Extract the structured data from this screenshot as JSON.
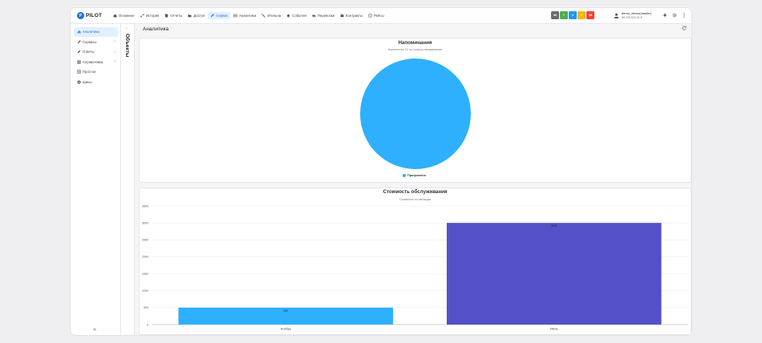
{
  "app": {
    "logo_text": "PILOT"
  },
  "nav": [
    {
      "label": "Основное",
      "icon": "home-icon",
      "active": false
    },
    {
      "label": "История",
      "icon": "route-icon",
      "active": false
    },
    {
      "label": "Отчёты",
      "icon": "document-icon",
      "active": false
    },
    {
      "label": "Доступ",
      "icon": "folder-icon",
      "active": false
    },
    {
      "label": "Сервис",
      "icon": "wrench-icon",
      "active": true
    },
    {
      "label": "Аналитика",
      "icon": "table-icon",
      "active": false
    },
    {
      "label": "Ительна",
      "icon": "satellite-icon",
      "active": false
    },
    {
      "label": "События",
      "icon": "bell-icon",
      "active": false
    },
    {
      "label": "Перевозки",
      "icon": "truck-icon",
      "active": false
    },
    {
      "label": "Контракты",
      "icon": "briefcase-icon",
      "active": false
    },
    {
      "label": "Рейсы",
      "icon": "list-icon",
      "active": false
    }
  ],
  "status_badges": [
    {
      "text": "66",
      "color": "#6b6b6b"
    },
    {
      "text": "7",
      "color": "#4caf50"
    },
    {
      "text": "3",
      "color": "#2196f3"
    },
    {
      "text": "0",
      "color": "#f5b800"
    },
    {
      "text": "48",
      "color": "#f44336"
    }
  ],
  "user": {
    "name": "demo_demo(master)",
    "balance": "68 235 822.33 ₽"
  },
  "sidebar": {
    "items": [
      {
        "label": "Аналитика",
        "icon": "chart-icon",
        "active": true,
        "chevron": false
      },
      {
        "label": "Сервисы",
        "icon": "wrench-icon",
        "active": false,
        "chevron": true
      },
      {
        "label": "Ответы",
        "icon": "edit-icon",
        "active": false,
        "chevron": true
      },
      {
        "label": "Справочники",
        "icon": "book-icon",
        "active": false,
        "chevron": true
      },
      {
        "label": "Простои",
        "icon": "grid-icon",
        "active": false,
        "chevron": false
      },
      {
        "label": "Шины",
        "icon": "tire-icon",
        "active": false,
        "chevron": false
      }
    ],
    "collapse_icon": "double-chevron-left-icon"
  },
  "objects_strip": {
    "label": "Объекты"
  },
  "page": {
    "title": "Аналитика"
  },
  "chart_data": [
    {
      "type": "pie",
      "title": "Напоминания",
      "subtitle": "Количество ТС по статусу напоминания",
      "categories": [
        "Просрочено"
      ],
      "values": [
        1
      ],
      "colors": [
        "#2eb0ff"
      ],
      "legend": "bottom"
    },
    {
      "type": "bar",
      "title": "Стоимость обслуживания",
      "subtitle": "Стоимость по месяцам",
      "categories": [
        "Ноябрь",
        "Июнь"
      ],
      "values": [
        500,
        3000
      ],
      "data_labels": [
        "500",
        "3000"
      ],
      "colors": [
        "#2eb0ff",
        "#5450c8"
      ],
      "ylim": [
        0,
        3500
      ],
      "yticks": [
        0,
        500,
        1000,
        1500,
        2000,
        2500,
        3000,
        3500
      ],
      "grid": true
    }
  ]
}
